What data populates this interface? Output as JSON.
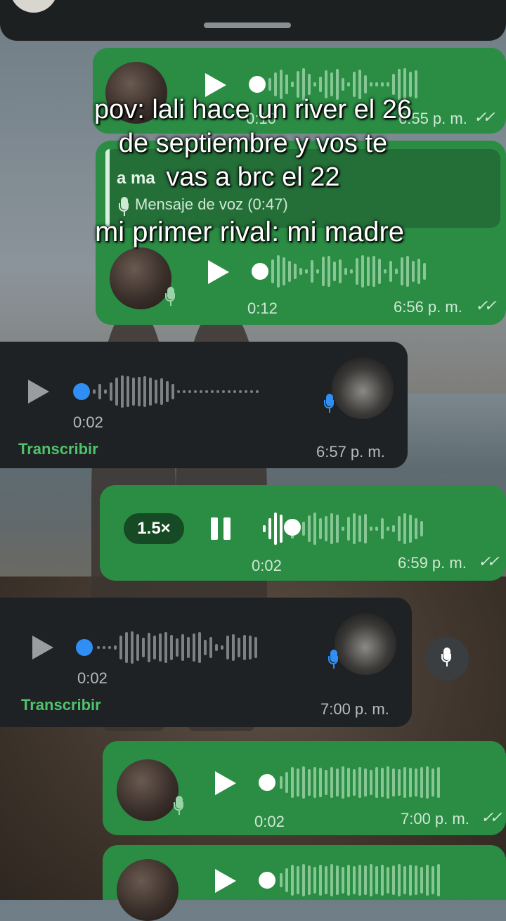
{
  "top_strip": {
    "label": "Mensaje de voz (0:47)"
  },
  "reply_card": {
    "sender_fragment": "a ma",
    "label": "Mensaje de voz (0:47)"
  },
  "caption": {
    "line1": "pov: lali hace un river el 26",
    "line2": "de septiembre y vos te",
    "line3": "vas a brc el 22",
    "line4": "mi primer rival: mi madre"
  },
  "messages": [
    {
      "type": "outgoing",
      "duration": "0:10",
      "timestamp": "6:55 p. m."
    },
    {
      "type": "outgoing",
      "duration": "0:12",
      "timestamp": "6:56 p. m."
    },
    {
      "type": "incoming",
      "duration": "0:02",
      "timestamp": "6:57 p. m.",
      "action": "Transcribir"
    },
    {
      "type": "outgoing_playing",
      "speed": "1.5×",
      "duration": "0:02",
      "timestamp": "6:59 p. m."
    },
    {
      "type": "incoming",
      "duration": "0:02",
      "timestamp": "7:00 p. m.",
      "action": "Transcribir"
    },
    {
      "type": "outgoing",
      "duration": "0:02",
      "timestamp": "7:00 p. m."
    }
  ],
  "colors": {
    "outgoing_bubble": "#2b8c44",
    "incoming_bubble": "#1f2224",
    "accent_blue": "#2f8ff5",
    "transcribe_green": "#4fc36b"
  },
  "icons": [
    "play-icon",
    "pause-icon",
    "mic-icon",
    "double-check-icon",
    "avatar"
  ]
}
